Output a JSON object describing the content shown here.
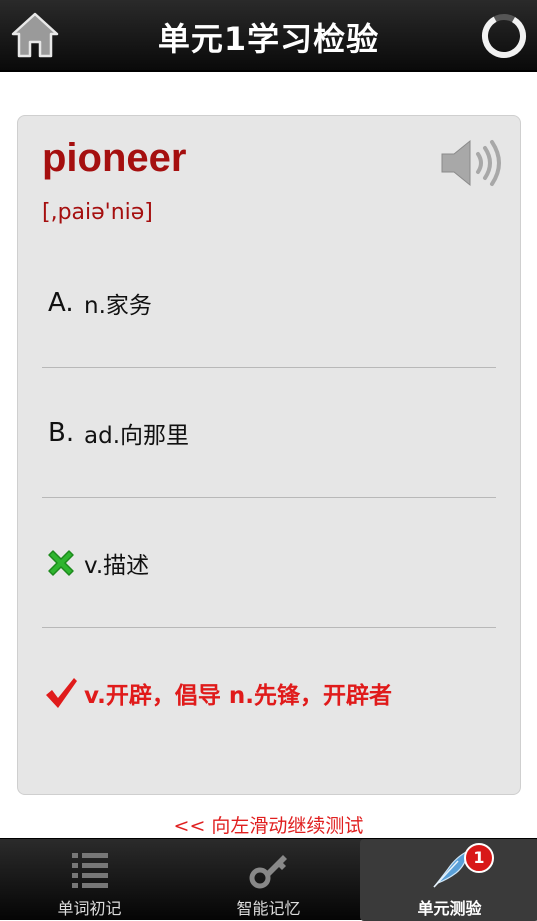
{
  "header": {
    "title": "单元1学习检验",
    "home_icon": "home-icon",
    "progress_icon": "progress-ring-icon"
  },
  "card": {
    "word": "pioneer",
    "phonetic": "[,paiə'niə]",
    "speaker_icon": "speaker-icon",
    "options": [
      {
        "letter": "A.",
        "text": "n.家务",
        "state": "normal"
      },
      {
        "letter": "B.",
        "text": "ad.向那里",
        "state": "normal"
      },
      {
        "letter": "",
        "text": "v.描述",
        "state": "wrong",
        "icon": "green-x-icon"
      },
      {
        "letter": "",
        "text": "v.开辟，倡导 n.先锋，开辟者",
        "state": "correct",
        "icon": "red-check-icon"
      }
    ]
  },
  "swipe_hint": "<< 向左滑动继续测试",
  "tabs": [
    {
      "label": "单词初记",
      "icon": "list-icon",
      "active": false
    },
    {
      "label": "智能记忆",
      "icon": "key-icon",
      "active": false
    },
    {
      "label": "单元测验",
      "icon": "feather-icon",
      "active": true,
      "badge": "1"
    }
  ],
  "colors": {
    "accent_red": "#a50f0f",
    "correct_red": "#e01b1b",
    "wrong_green": "#2fb52f",
    "bar_dark": "#111111"
  }
}
